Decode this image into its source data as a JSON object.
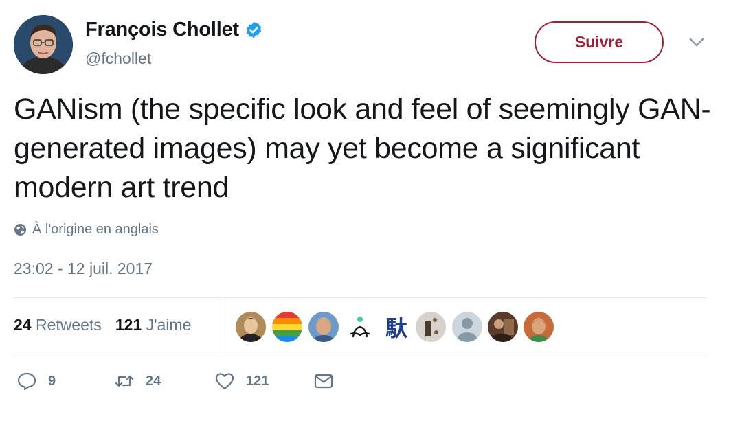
{
  "author": {
    "name": "François Chollet",
    "handle": "@fchollet",
    "verified_icon": "verified-badge-icon"
  },
  "follow": {
    "label": "Suivre"
  },
  "tweet": {
    "text": "GANism (the specific look and feel of seemingly GAN-generated images) may yet become a significant modern art trend",
    "translation_note": "À l'origine en anglais",
    "timestamp": "23:02 - 12 juil. 2017"
  },
  "stats": {
    "retweets_count": "24",
    "retweets_label": "Retweets",
    "likes_count": "121",
    "likes_label": "J'aime"
  },
  "likers": [
    {
      "name": "liker-1",
      "kind": "photo"
    },
    {
      "name": "liker-2",
      "kind": "rainbow"
    },
    {
      "name": "liker-3",
      "kind": "photo"
    },
    {
      "name": "liker-4",
      "kind": "glyph"
    },
    {
      "name": "liker-5",
      "kind": "kanji",
      "text": "馱"
    },
    {
      "name": "liker-6",
      "kind": "photo"
    },
    {
      "name": "liker-7",
      "kind": "default"
    },
    {
      "name": "liker-8",
      "kind": "photo"
    },
    {
      "name": "liker-9",
      "kind": "photo"
    }
  ],
  "actions": {
    "reply_count": "9",
    "retweet_count": "24",
    "like_count": "121"
  },
  "colors": {
    "follow_accent": "#a12034",
    "secondary_text": "#657786",
    "verified_blue": "#1da1f2"
  }
}
